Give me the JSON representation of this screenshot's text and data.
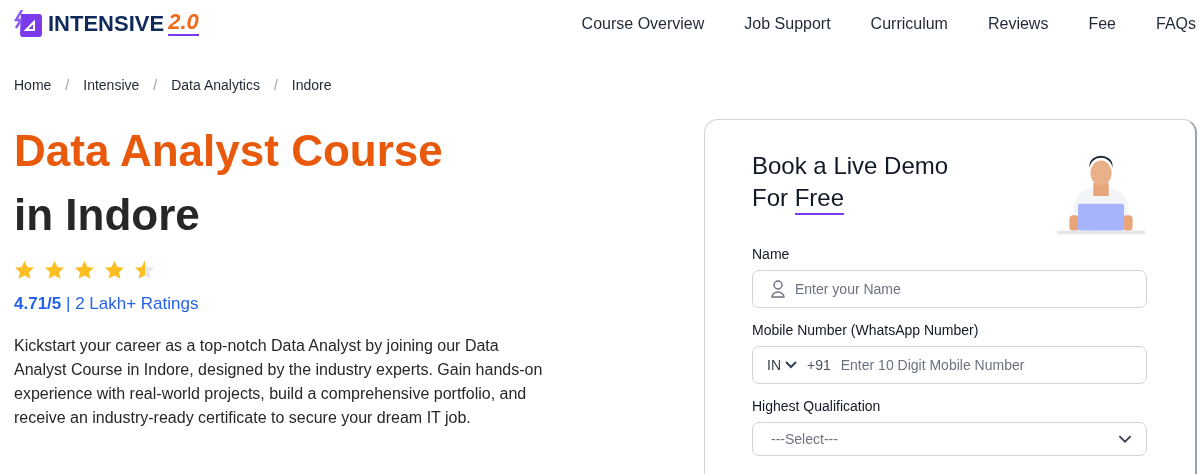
{
  "header": {
    "logo_text": "INTENSIVE",
    "logo_version": "2.0",
    "nav": [
      {
        "label": "Course Overview"
      },
      {
        "label": "Job Support"
      },
      {
        "label": "Curriculum"
      },
      {
        "label": "Reviews"
      },
      {
        "label": "Fee"
      },
      {
        "label": "FAQs"
      }
    ]
  },
  "breadcrumb": {
    "separator": "/",
    "items": [
      "Home",
      "Intensive",
      "Data Analytics",
      "Indore"
    ]
  },
  "hero": {
    "title_line_1": "Data Analyst Course",
    "title_line_2": "in Indore",
    "stars": 4.5,
    "rating": "4.71/5",
    "rating_count": "| 2 Lakh+ Ratings",
    "description": "Kickstart your career as a top-notch Data Analyst by joining our Data Analyst Course in Indore, designed by the industry experts. Gain hands-on experience with real-world projects, build a comprehensive portfolio, and receive an industry-ready certificate to secure your dream IT job."
  },
  "form": {
    "title_line_1": "Book a Live Demo",
    "title_line_2_start": "For",
    "title_line_2_highlight": "Free",
    "fields": [
      {
        "kind": "text",
        "label": "Name",
        "placeholder": "Enter your Name"
      },
      {
        "kind": "phone",
        "label": "Mobile Number (WhatsApp Number)",
        "country": "IN",
        "code": "+91",
        "placeholder": "Enter 10 Digit Mobile Number"
      },
      {
        "kind": "select",
        "label": "Highest Qualification",
        "value": "---Select---"
      }
    ]
  }
}
